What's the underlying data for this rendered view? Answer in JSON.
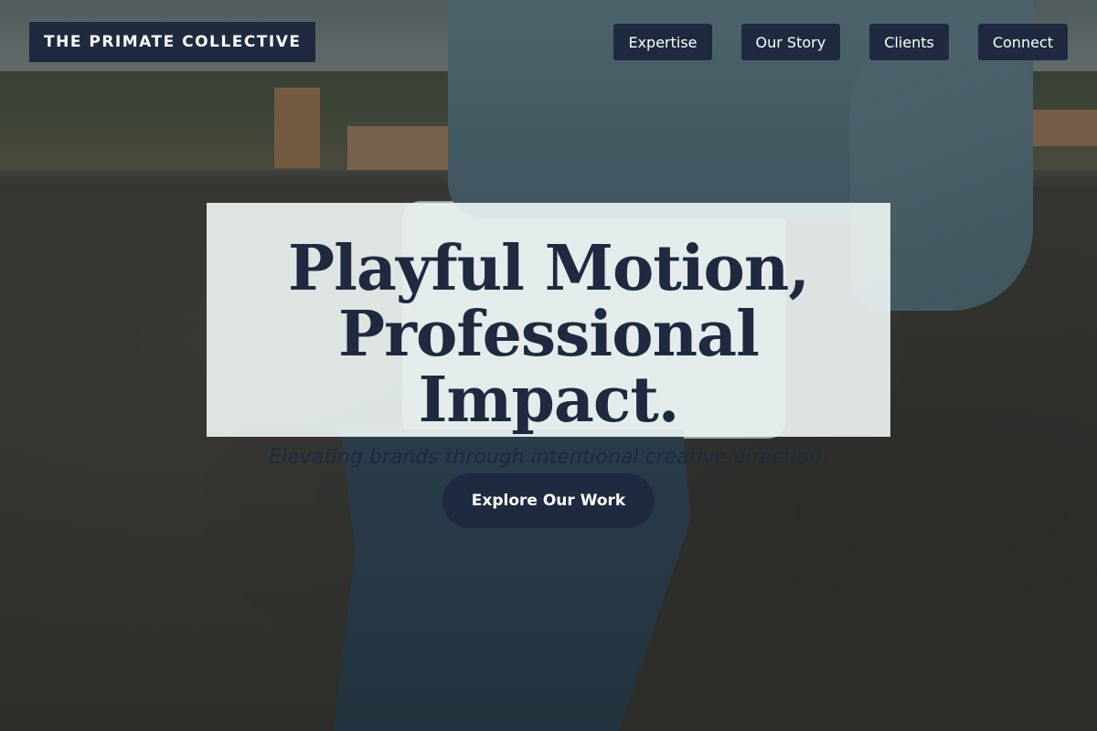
{
  "header": {
    "brand": "THE PRIMATE COLLECTIVE",
    "nav": [
      "Expertise",
      "Our Story",
      "Clients",
      "Connect"
    ]
  },
  "hero": {
    "title_line1": "Playful Motion,",
    "title_line2": "Professional Impact.",
    "subtitle": "Elevating brands through intentional creative direction.",
    "cta_label": "Explore Our Work"
  },
  "colors": {
    "navy": "#1f2a40",
    "card": "#e9f1f0",
    "text_light": "#ffffff"
  }
}
